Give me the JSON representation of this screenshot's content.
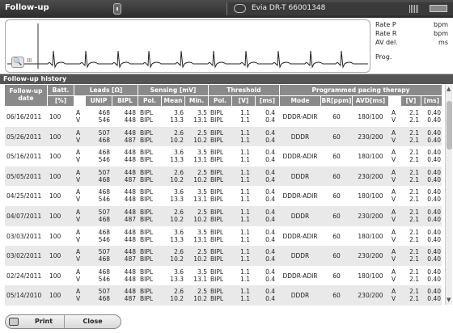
{
  "titlebar": {
    "title": "Follow-up",
    "device": "Evia DR-T 66001348"
  },
  "rates": [
    {
      "label": "Rate P",
      "unit": "bpm"
    },
    {
      "label": "Rate R",
      "unit": "bpm"
    },
    {
      "label": "AV del.",
      "unit": "ms"
    },
    {
      "label": "Prog.",
      "unit": ""
    }
  ],
  "ecg_label": "III",
  "history": {
    "title": "Follow-up history",
    "headers": {
      "date": "Follow-up date",
      "batt": "Batt.",
      "batt_unit": "[%]",
      "leads": "Leads [Ω]",
      "leads_unip": "UNIP",
      "leads_bipl": "BIPL",
      "sensing": "Sensing [mV]",
      "sens_pol": "Pol.",
      "sens_mean": "Mean",
      "sens_min": "Min.",
      "threshold": "Threshold",
      "th_pol": "Pol.",
      "th_v": "[V]",
      "th_ms": "[ms]",
      "therapy": "Programmed pacing therapy",
      "mode": "Mode",
      "br": "BR[ppm]",
      "avd": "AVD[ms]",
      "pv": "[V]",
      "pms": "[ms]"
    },
    "rows": [
      {
        "date": "06/16/2011",
        "batt": "100",
        "chan": "A\nV",
        "unip": "468\n546",
        "bipl": "448\n448",
        "spol": "BIPL\nBIPL",
        "smean": "3.6\n13.3",
        "smin": "3.5\n13.1",
        "tpol": "BIPL\nBIPL",
        "tv": "1.1\n1.1",
        "tms": "0.4\n0.4",
        "mode": "DDDR-ADIR",
        "br": "60",
        "avd": "180/100",
        "pchan": "A\nV",
        "pv": "2.1\n2.1",
        "pms": "0.40\n0.40"
      },
      {
        "date": "05/26/2011",
        "batt": "100",
        "chan": "A\nV",
        "unip": "507\n468",
        "bipl": "448\n487",
        "spol": "BIPL\nBIPL",
        "smean": "2.6\n10.2",
        "smin": "2.5\n10.2",
        "tpol": "BIPL\nBIPL",
        "tv": "1.1\n1.1",
        "tms": "0.4\n0.4",
        "mode": "DDDR",
        "br": "60",
        "avd": "230/200",
        "pchan": "A\nV",
        "pv": "2.1\n2.1",
        "pms": "0.40\n0.40"
      },
      {
        "date": "05/16/2011",
        "batt": "100",
        "chan": "A\nV",
        "unip": "468\n546",
        "bipl": "448\n448",
        "spol": "BIPL\nBIPL",
        "smean": "3.6\n13.3",
        "smin": "3.5\n13.1",
        "tpol": "BIPL\nBIPL",
        "tv": "1.1\n1.1",
        "tms": "0.4\n0.4",
        "mode": "DDDR-ADIR",
        "br": "60",
        "avd": "180/100",
        "pchan": "A\nV",
        "pv": "2.1\n2.1",
        "pms": "0.40\n0.40"
      },
      {
        "date": "05/05/2011",
        "batt": "100",
        "chan": "A\nV",
        "unip": "507\n468",
        "bipl": "448\n487",
        "spol": "BIPL\nBIPL",
        "smean": "2.6\n10.2",
        "smin": "2.5\n10.2",
        "tpol": "BIPL\nBIPL",
        "tv": "1.1\n1.1",
        "tms": "0.4\n0.4",
        "mode": "DDDR",
        "br": "60",
        "avd": "230/200",
        "pchan": "A\nV",
        "pv": "2.1\n2.1",
        "pms": "0.40\n0.40"
      },
      {
        "date": "04/25/2011",
        "batt": "100",
        "chan": "A\nV",
        "unip": "468\n546",
        "bipl": "448\n448",
        "spol": "BIPL\nBIPL",
        "smean": "3.6\n13.3",
        "smin": "3.5\n13.1",
        "tpol": "BIPL\nBIPL",
        "tv": "1.1\n1.1",
        "tms": "0.4\n0.4",
        "mode": "DDDR-ADIR",
        "br": "60",
        "avd": "180/100",
        "pchan": "A\nV",
        "pv": "2.1\n2.1",
        "pms": "0.40\n0.40"
      },
      {
        "date": "04/07/2011",
        "batt": "100",
        "chan": "A\nV",
        "unip": "507\n468",
        "bipl": "448\n487",
        "spol": "BIPL\nBIPL",
        "smean": "2.6\n10.2",
        "smin": "2.5\n10.2",
        "tpol": "BIPL\nBIPL",
        "tv": "1.1\n1.1",
        "tms": "0.4\n0.4",
        "mode": "DDDR",
        "br": "60",
        "avd": "230/200",
        "pchan": "A\nV",
        "pv": "2.1\n2.1",
        "pms": "0.40\n0.40"
      },
      {
        "date": "03/03/2011",
        "batt": "100",
        "chan": "A\nV",
        "unip": "468\n546",
        "bipl": "448\n448",
        "spol": "BIPL\nBIPL",
        "smean": "3.6\n13.3",
        "smin": "3.5\n13.1",
        "tpol": "BIPL\nBIPL",
        "tv": "1.1\n1.1",
        "tms": "0.4\n0.4",
        "mode": "DDDR-ADIR",
        "br": "60",
        "avd": "180/100",
        "pchan": "A\nV",
        "pv": "2.1\n2.1",
        "pms": "0.40\n0.40"
      },
      {
        "date": "03/02/2011",
        "batt": "100",
        "chan": "A\nV",
        "unip": "507\n468",
        "bipl": "448\n487",
        "spol": "BIPL\nBIPL",
        "smean": "2.6\n10.2",
        "smin": "2.5\n10.2",
        "tpol": "BIPL\nBIPL",
        "tv": "1.1\n1.1",
        "tms": "0.4\n0.4",
        "mode": "DDDR",
        "br": "60",
        "avd": "230/200",
        "pchan": "A\nV",
        "pv": "2.1\n2.1",
        "pms": "0.40\n0.40"
      },
      {
        "date": "02/24/2011",
        "batt": "100",
        "chan": "A\nV",
        "unip": "468\n546",
        "bipl": "448\n448",
        "spol": "BIPL\nBIPL",
        "smean": "3.6\n13.3",
        "smin": "3.5\n13.1",
        "tpol": "BIPL\nBIPL",
        "tv": "1.1\n1.1",
        "tms": "0.4\n0.4",
        "mode": "DDDR-ADIR",
        "br": "60",
        "avd": "180/100",
        "pchan": "A\nV",
        "pv": "2.1\n2.1",
        "pms": "0.40\n0.40"
      },
      {
        "date": "05/14/2010",
        "batt": "100",
        "chan": "A\nV",
        "unip": "507\n468",
        "bipl": "448\n487",
        "spol": "BIPL\nBIPL",
        "smean": "2.6\n10.2",
        "smin": "2.5\n10.2",
        "tpol": "BIPL\nBIPL",
        "tv": "1.1\n1.1",
        "tms": "0.4\n0.4",
        "mode": "DDDR",
        "br": "60",
        "avd": "230/200",
        "pchan": "A\nV",
        "pv": "2.1\n2.1",
        "pms": "0.40\n0.40"
      }
    ]
  },
  "buttons": {
    "print": "Print",
    "close": "Close"
  },
  "colors": {
    "header_bg": "#8a8a8a",
    "titlebar_bg": "#3a3a3a",
    "ecg_trace": "#222222"
  }
}
